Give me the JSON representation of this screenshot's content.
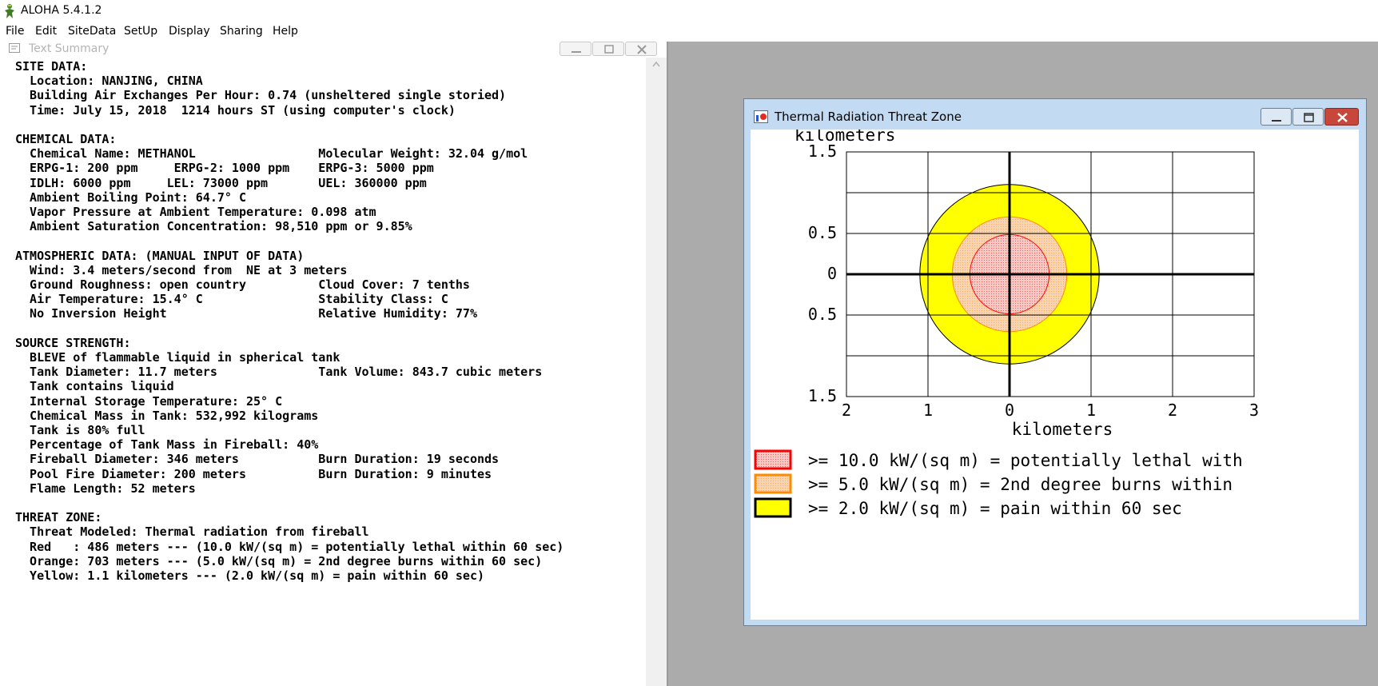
{
  "app": {
    "title": "ALOHA 5.4.1.2"
  },
  "menu": [
    "File",
    "Edit",
    "SiteData",
    "SetUp",
    "Display",
    "Sharing",
    "Help"
  ],
  "text_summary": {
    "title": "Text Summary",
    "lines": [
      "SITE DATA:",
      "  Location: NANJING, CHINA",
      "  Building Air Exchanges Per Hour: 0.74 (unsheltered single storied)",
      "  Time: July 15, 2018  1214 hours ST (using computer's clock)",
      "",
      "CHEMICAL DATA:",
      "  Chemical Name: METHANOL                 Molecular Weight: 32.04 g/mol",
      "  ERPG-1: 200 ppm     ERPG-2: 1000 ppm    ERPG-3: 5000 ppm",
      "  IDLH: 6000 ppm     LEL: 73000 ppm       UEL: 360000 ppm",
      "  Ambient Boiling Point: 64.7° C",
      "  Vapor Pressure at Ambient Temperature: 0.098 atm",
      "  Ambient Saturation Concentration: 98,510 ppm or 9.85%",
      "",
      "ATMOSPHERIC DATA: (MANUAL INPUT OF DATA)",
      "  Wind: 3.4 meters/second from  NE at 3 meters",
      "  Ground Roughness: open country          Cloud Cover: 7 tenths",
      "  Air Temperature: 15.4° C                Stability Class: C",
      "  No Inversion Height                     Relative Humidity: 77%",
      "",
      "SOURCE STRENGTH:",
      "  BLEVE of flammable liquid in spherical tank",
      "  Tank Diameter: 11.7 meters              Tank Volume: 843.7 cubic meters",
      "  Tank contains liquid",
      "  Internal Storage Temperature: 25° C",
      "  Chemical Mass in Tank: 532,992 kilograms",
      "  Tank is 80% full",
      "  Percentage of Tank Mass in Fireball: 40%",
      "  Fireball Diameter: 346 meters           Burn Duration: 19 seconds",
      "  Pool Fire Diameter: 200 meters          Burn Duration: 9 minutes",
      "  Flame Length: 52 meters",
      "",
      "THREAT ZONE:",
      "  Threat Modeled: Thermal radiation from fireball",
      "  Red   : 486 meters --- (10.0 kW/(sq m) = potentially lethal within 60 sec)",
      "  Orange: 703 meters --- (5.0 kW/(sq m) = 2nd degree burns within 60 sec)",
      "  Yellow: 1.1 kilometers --- (2.0 kW/(sq m) = pain within 60 sec)"
    ]
  },
  "threat_window": {
    "title": "Thermal Radiation Threat Zone",
    "y_unit": "kilometers",
    "x_unit": "kilometers",
    "y_tick_labels": [
      "1.5",
      "0.5",
      "0",
      "0.5",
      "1.5"
    ],
    "x_tick_labels": [
      "2",
      "1",
      "0",
      "1",
      "2",
      "3"
    ],
    "legend": [
      {
        "label": ">= 10.0 kW/(sq m) = potentially lethal with",
        "fill": "#f7c9c4",
        "border": "#ff0000"
      },
      {
        "label": ">= 5.0 kW/(sq m) = 2nd degree burns within",
        "fill": "#f8d4b2",
        "border": "#ff8c00"
      },
      {
        "label": ">= 2.0 kW/(sq m) = pain within 60 sec",
        "fill": "#ffff00",
        "border": "#000000"
      }
    ]
  },
  "chart_data": {
    "type": "area",
    "x_range": [
      -2,
      3
    ],
    "y_range": [
      -1.5,
      1.5
    ],
    "grid": true,
    "zones": [
      {
        "name": "Red",
        "radius_km": 0.486,
        "fill": "#f7c9c4",
        "stroke": "#ff0000"
      },
      {
        "name": "Orange",
        "radius_km": 0.703,
        "fill": "#f8d4b2",
        "stroke": "#ff8c00"
      },
      {
        "name": "Yellow",
        "radius_km": 1.1,
        "fill": "#ffff00",
        "stroke": "#000000"
      }
    ]
  }
}
